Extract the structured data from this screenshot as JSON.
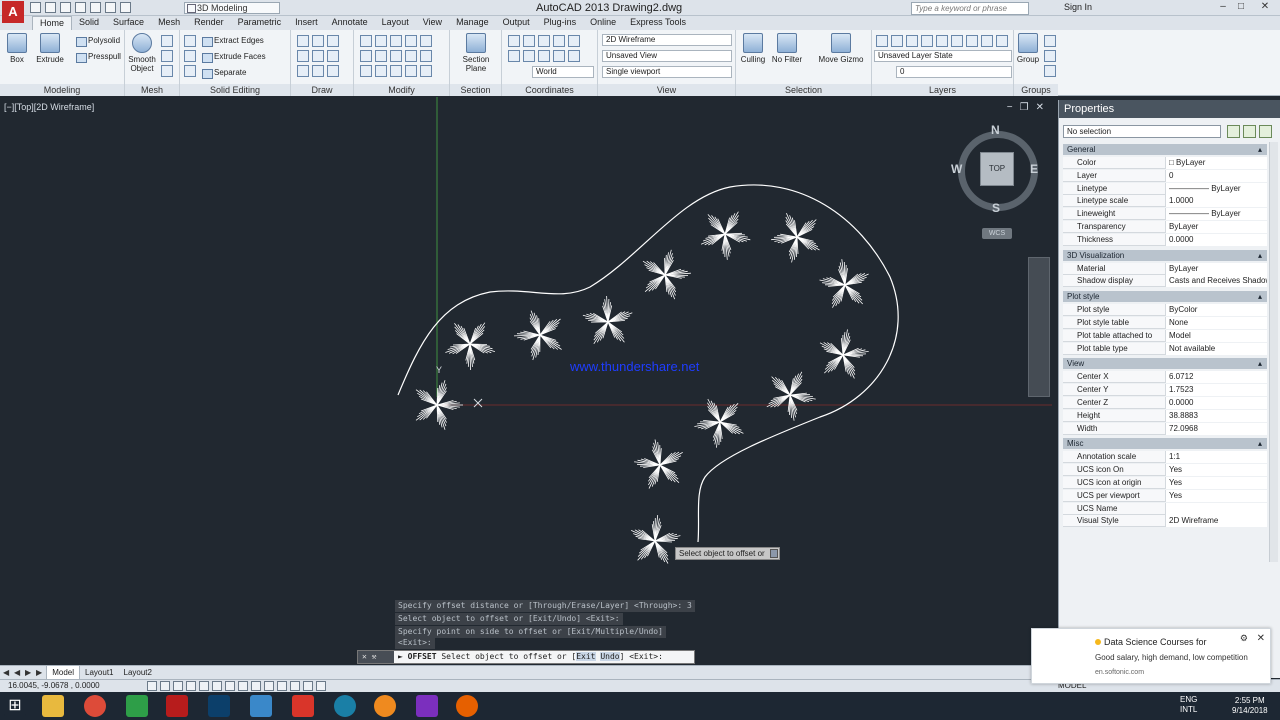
{
  "app": {
    "logo": "A",
    "title": "AutoCAD 2013    Drawing2.dwg",
    "workspace": "3D Modeling",
    "search_placeholder": "Type a keyword or phrase",
    "sign_in": "Sign In"
  },
  "ribbon_tabs": [
    "Home",
    "Solid",
    "Surface",
    "Mesh",
    "Render",
    "Parametric",
    "Insert",
    "Annotate",
    "Layout",
    "View",
    "Manage",
    "Output",
    "Plug-ins",
    "Online",
    "Express Tools"
  ],
  "ribbon": {
    "box": "Box",
    "extrude": "Extrude",
    "polysolid": "Polysolid",
    "presspull": "Presspull",
    "smooth_object": "Smooth Object",
    "extract_edges": "Extract Edges",
    "extrude_faces": "Extrude Faces",
    "separate": "Separate",
    "section_plane": "Section Plane",
    "world": "World",
    "visual_style": "2D Wireframe",
    "view_name": "Unsaved View",
    "viewport_config": "Single viewport",
    "culling": "Culling",
    "no_filter": "No Filter",
    "move_gizmo": "Move Gizmo",
    "layer_state": "Unsaved Layer State",
    "layer_current": "0",
    "group": "Group",
    "panels": [
      "Modeling",
      "Mesh",
      "Solid Editing",
      "Draw",
      "Modify",
      "Section",
      "Coordinates",
      "View",
      "Selection",
      "Layers",
      "Groups"
    ]
  },
  "viewport": {
    "label": "[−][Top][2D Wireframe]",
    "controls": [
      "−",
      "❐",
      "✕"
    ],
    "watermark": "www.thundershare.net",
    "tooltip": "Select object to offset or",
    "compass": {
      "n": "N",
      "s": "S",
      "e": "E",
      "w": "W"
    },
    "cube_face": "TOP",
    "wcs": "WCS",
    "ucs_y": "Y"
  },
  "command": {
    "history": [
      "Specify offset distance or [Through/Erase/Layer] <Through>: 3",
      "Select object to offset or [Exit/Undo] <Exit>:",
      "Specify point on side to offset or [Exit/Multiple/Undo]",
      "<Exit>:"
    ],
    "prompt_cmd": "OFFSET",
    "prompt_text": " Select object to offset or [",
    "prompt_opt1": "Exit",
    "prompt_opt2": "Undo",
    "prompt_tail": "] <Exit>:"
  },
  "layout_tabs": [
    "Model",
    "Layout1",
    "Layout2"
  ],
  "status": {
    "coords": "16.0045, -9.0678 , 0.0000",
    "model": "MODEL"
  },
  "properties": {
    "title": "Properties",
    "selection": "No selection",
    "sections": [
      {
        "name": "General",
        "rows": [
          {
            "k": "Color",
            "v": "□ ByLayer"
          },
          {
            "k": "Layer",
            "v": "0"
          },
          {
            "k": "Linetype",
            "v": "————— ByLayer"
          },
          {
            "k": "Linetype scale",
            "v": "1.0000"
          },
          {
            "k": "Lineweight",
            "v": "————— ByLayer"
          },
          {
            "k": "Transparency",
            "v": "ByLayer"
          },
          {
            "k": "Thickness",
            "v": "0.0000"
          }
        ]
      },
      {
        "name": "3D Visualization",
        "rows": [
          {
            "k": "Material",
            "v": "ByLayer"
          },
          {
            "k": "Shadow display",
            "v": "Casts and Receives Shadows"
          }
        ]
      },
      {
        "name": "Plot style",
        "rows": [
          {
            "k": "Plot style",
            "v": "ByColor"
          },
          {
            "k": "Plot style table",
            "v": "None"
          },
          {
            "k": "Plot table attached to",
            "v": "Model"
          },
          {
            "k": "Plot table type",
            "v": "Not available"
          }
        ]
      },
      {
        "name": "View",
        "rows": [
          {
            "k": "Center X",
            "v": "6.0712"
          },
          {
            "k": "Center Y",
            "v": "1.7523"
          },
          {
            "k": "Center Z",
            "v": "0.0000"
          },
          {
            "k": "Height",
            "v": "38.8883"
          },
          {
            "k": "Width",
            "v": "72.0968"
          }
        ]
      },
      {
        "name": "Misc",
        "rows": [
          {
            "k": "Annotation scale",
            "v": "1:1"
          },
          {
            "k": "UCS icon On",
            "v": "Yes"
          },
          {
            "k": "UCS icon at origin",
            "v": "Yes"
          },
          {
            "k": "UCS per viewport",
            "v": "Yes"
          },
          {
            "k": "UCS Name",
            "v": ""
          },
          {
            "k": "Visual Style",
            "v": "2D Wireframe"
          }
        ]
      }
    ]
  },
  "notification": {
    "title": "Data Science Courses for",
    "body": "Good salary, high demand, low competition",
    "source": "en.softonic.com"
  },
  "taskbar": {
    "lang1": "ENG",
    "lang2": "INTL",
    "time": "2:55 PM",
    "date": "9/14/2018"
  },
  "colors": {
    "canvas": "#212830",
    "accent": "#c62828",
    "watermark": "#1f3dff"
  }
}
